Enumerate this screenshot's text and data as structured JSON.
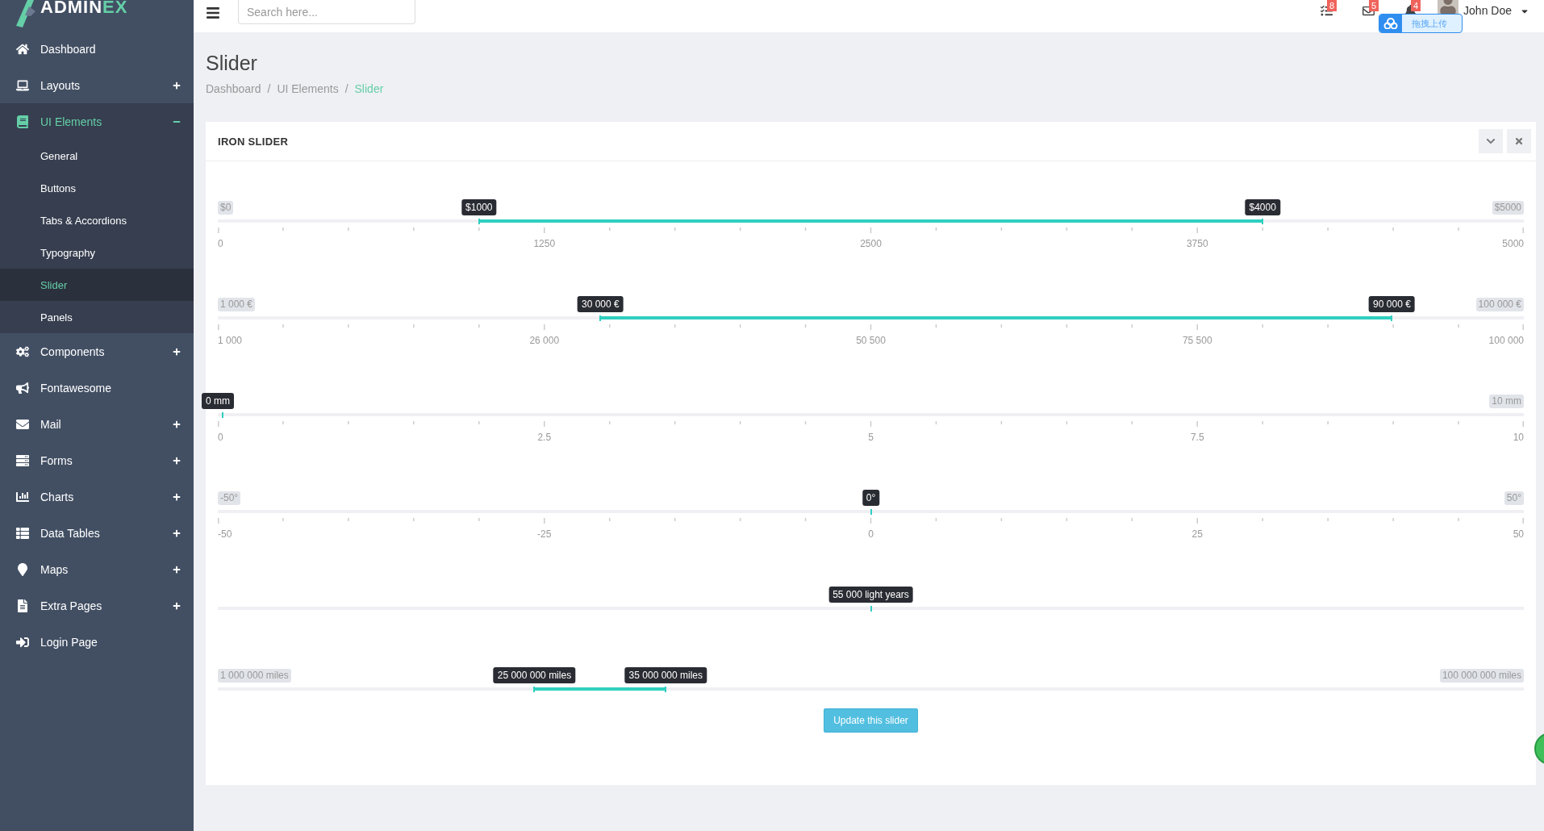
{
  "logo": {
    "text": "ADMIN",
    "accent": "EX"
  },
  "sidebar": {
    "items": [
      {
        "label": "Dashboard",
        "expandable": false,
        "expanded": false
      },
      {
        "label": "Layouts",
        "expandable": true,
        "expanded": false
      },
      {
        "label": "UI Elements",
        "expandable": true,
        "expanded": true,
        "children": [
          {
            "label": "General",
            "selected": false
          },
          {
            "label": "Buttons",
            "selected": false
          },
          {
            "label": "Tabs & Accordions",
            "selected": false
          },
          {
            "label": "Typography",
            "selected": false
          },
          {
            "label": "Slider",
            "selected": true
          },
          {
            "label": "Panels",
            "selected": false
          }
        ]
      },
      {
        "label": "Components",
        "expandable": true,
        "expanded": false
      },
      {
        "label": "Fontawesome",
        "expandable": false,
        "expanded": false
      },
      {
        "label": "Mail",
        "expandable": true,
        "expanded": false
      },
      {
        "label": "Forms",
        "expandable": true,
        "expanded": false
      },
      {
        "label": "Charts",
        "expandable": true,
        "expanded": false
      },
      {
        "label": "Data Tables",
        "expandable": true,
        "expanded": false
      },
      {
        "label": "Maps",
        "expandable": true,
        "expanded": false
      },
      {
        "label": "Extra Pages",
        "expandable": true,
        "expanded": false
      },
      {
        "label": "Login Page",
        "expandable": false,
        "expanded": false
      }
    ]
  },
  "header": {
    "search": {
      "placeholder": "Search here..."
    },
    "notifications": [
      {
        "count": "8"
      },
      {
        "count": "5"
      },
      {
        "count": "4"
      }
    ],
    "user": {
      "name": "John Doe"
    }
  },
  "upload_widget": {
    "label": "拖拽上传"
  },
  "page": {
    "title": "Slider",
    "breadcrumbs": [
      {
        "label": "Dashboard",
        "active": false
      },
      {
        "separator": "/",
        "label": "UI Elements",
        "active": false
      },
      {
        "separator": "/",
        "label": "Slider",
        "active": true
      }
    ]
  },
  "panel": {
    "title": "IRON SLIDER",
    "sliders": [
      {
        "kind": "double",
        "min_label": "$0",
        "max_label": "$5000",
        "handles": [
          {
            "label": "$1000",
            "level": 0.2
          },
          {
            "label": "$4000",
            "level": 0.8
          }
        ],
        "grid": [
          "0",
          "1250",
          "2500",
          "3750",
          "5000"
        ]
      },
      {
        "kind": "double",
        "min_label": "1 000 €",
        "max_label": "100 000 €",
        "handles": [
          {
            "label": "30 000 €",
            "level": 0.293
          },
          {
            "label": "90 000 €",
            "level": 0.899
          }
        ],
        "grid": [
          "1 000",
          "26 000",
          "50 500",
          "75 500",
          "100 000"
        ]
      },
      {
        "kind": "single",
        "max_label": "10 mm",
        "handles": [
          {
            "label": "0 mm",
            "level": 0
          }
        ],
        "grid": [
          "0",
          "2.5",
          "5",
          "7.5",
          "10"
        ]
      },
      {
        "kind": "single",
        "min_label": "-50°",
        "max_label": "50°",
        "handles": [
          {
            "label": "0°",
            "level": 0.5
          }
        ],
        "grid": [
          "-50",
          "-25",
          "0",
          "25",
          "50"
        ]
      },
      {
        "kind": "single",
        "handles": [
          {
            "label": "55 000 light years",
            "level": 0.5
          }
        ]
      },
      {
        "kind": "double",
        "min_label": "1 000 000 miles",
        "max_label": "100 000 000 miles",
        "handles": [
          {
            "label": "25 000 000 miles",
            "level": 0.2424
          },
          {
            "label": "35 000 000 miles",
            "level": 0.343
          }
        ]
      }
    ],
    "button": "Update this slider"
  }
}
